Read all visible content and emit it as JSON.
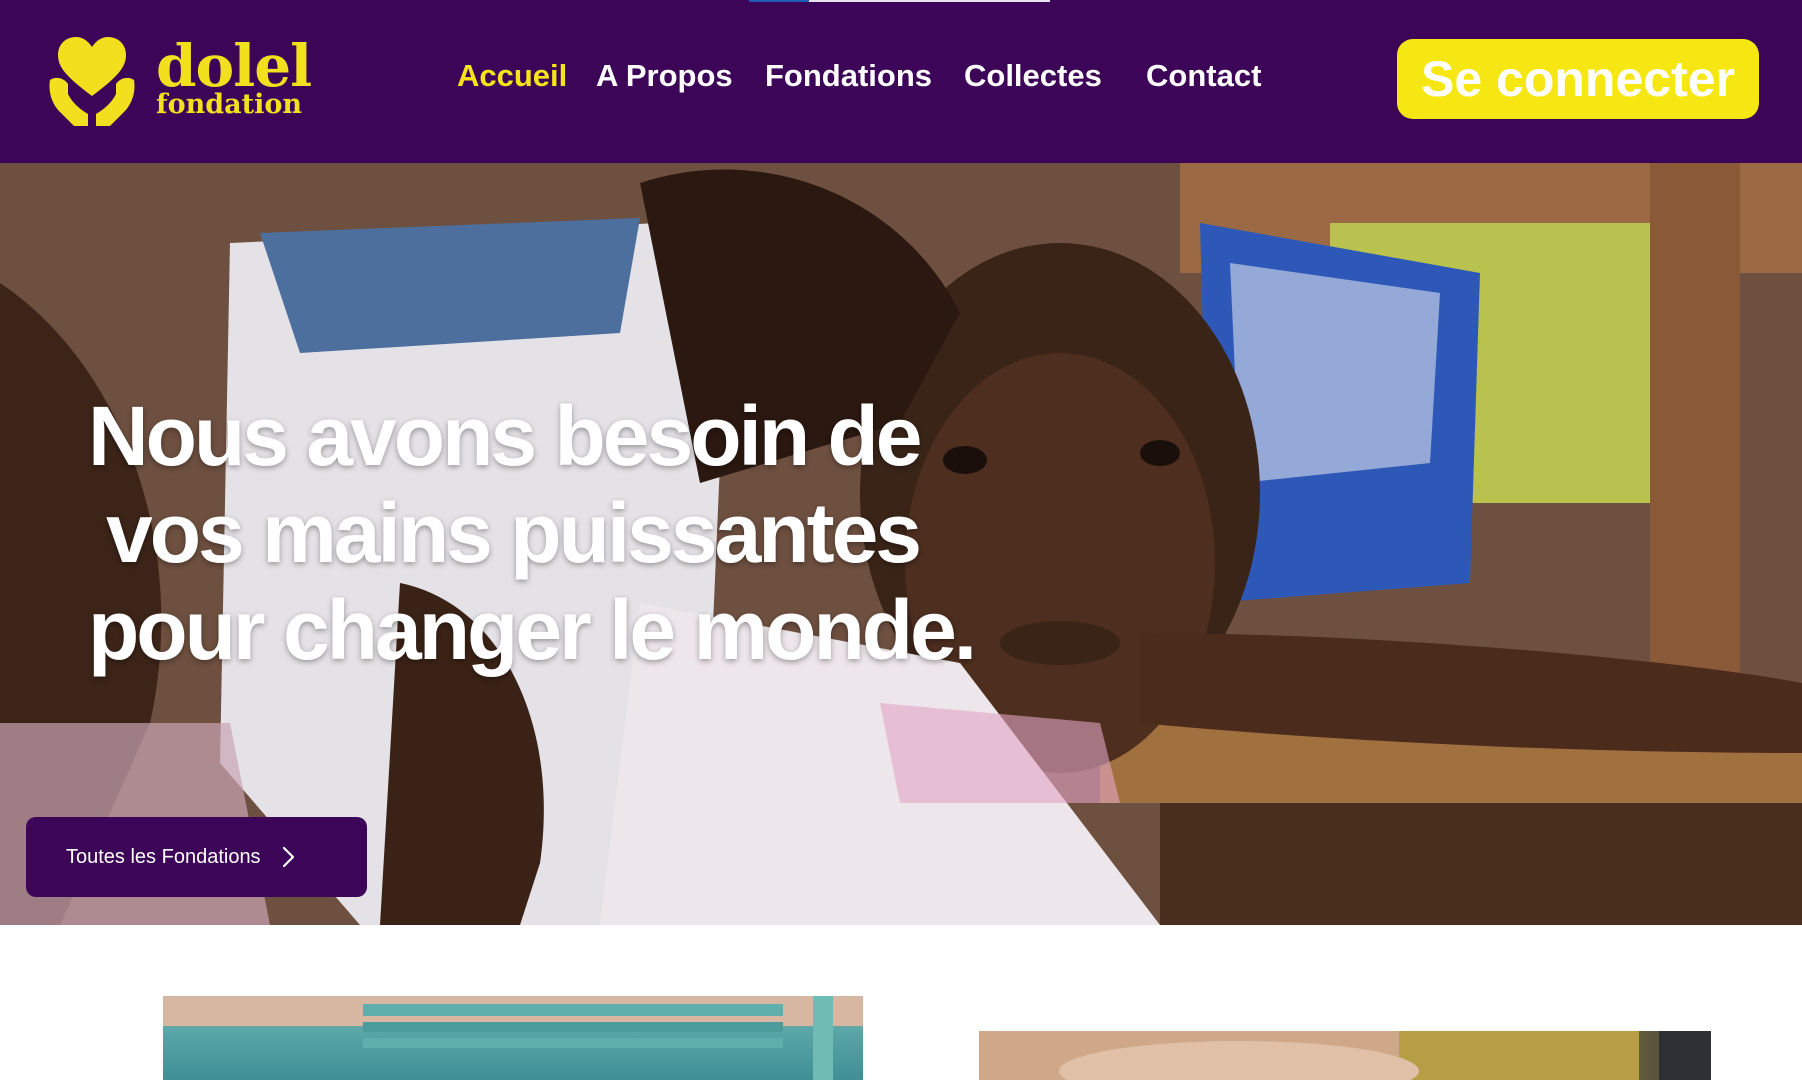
{
  "brand": {
    "name": "dolel",
    "tagline": "fondation",
    "logo_icon": "heart-hands-icon",
    "accent_color": "#f5e41a",
    "primary_color": "#3c0558"
  },
  "nav": {
    "items": [
      {
        "label": "Accueil",
        "active": true
      },
      {
        "label": "A Propos",
        "active": false
      },
      {
        "label": "Fondations",
        "active": false
      },
      {
        "label": "Collectes",
        "active": false
      },
      {
        "label": "Contact",
        "active": false
      }
    ],
    "login_label": "Se connecter"
  },
  "hero": {
    "title_lines": [
      "Nous avons besoin de",
      "vos mains puissantes",
      "pour changer le monde."
    ],
    "cta_label": "Toutes les Fondations",
    "cta_icon": "chevron-right-icon"
  }
}
